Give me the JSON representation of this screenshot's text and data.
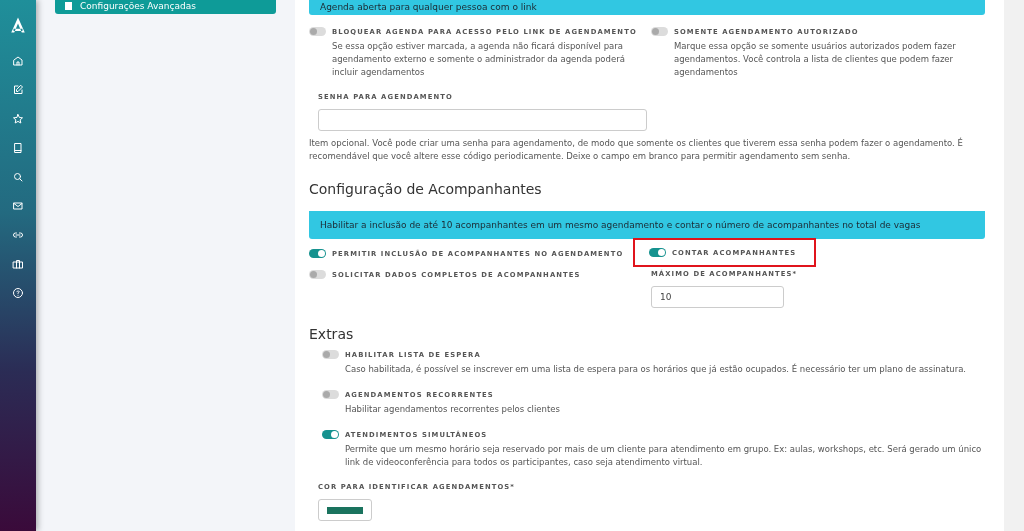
{
  "sidebar_panel": {
    "items": [
      {
        "label": "Configurações Avançadas",
        "selected": true
      }
    ]
  },
  "access": {
    "banner": "Agenda aberta para qualquer pessoa com o link",
    "toggles": [
      {
        "label": "BLOQUEAR AGENDA PARA ACESSO PELO LINK DE AGENDAMENTO",
        "description": "Se essa opção estiver marcada, a agenda não ficará disponível para agendamento externo e somente o administrador da agenda poderá incluir agendamentos",
        "on": false
      },
      {
        "label": "SOMENTE AGENDAMENTO AUTORIZADO",
        "description": "Marque essa opção se somente usuários autorizados podem fazer agendamentos. Você controla a lista de clientes que podem fazer agendamentos",
        "on": false
      }
    ],
    "password": {
      "label": "SENHA PARA AGENDAMENTO",
      "help": "Item opcional. Você pode criar uma senha para agendamento, de modo que somente os clientes que tiverem essa senha podem fazer o agendamento. É recomendável que você altere esse código periodicamente. Deixe o campo em branco para permitir agendamento sem senha."
    }
  },
  "companions": {
    "title": "Configuração de Acompanhantes",
    "banner": "Habilitar a inclusão de até 10 acompanhantes em um mesmo agendamento e contar o número de acompanhantes no total de vagas",
    "toggles": [
      {
        "label": "PERMITIR INCLUSÃO DE ACOMPANHANTES NO AGENDAMENTO",
        "on": true,
        "highlighted": false
      },
      {
        "label": "CONTAR ACOMPANHANTES",
        "on": true,
        "highlighted": true
      },
      {
        "label": "SOLICITAR DADOS COMPLETOS DE ACOMPANHANTES",
        "on": false,
        "highlighted": false
      }
    ],
    "max": {
      "label": "MÁXIMO DE ACOMPANHANTES*",
      "value": "10"
    }
  },
  "extras": {
    "title": "Extras",
    "toggles": [
      {
        "label": "HABILITAR LISTA DE ESPERA",
        "description": "Caso habilitada, é possível se inscrever em uma lista de espera para os horários que já estão ocupados. É necessário ter um plano de assinatura.",
        "on": false
      },
      {
        "label": "AGENDAMENTOS RECORRENTES",
        "description": "Habilitar agendamentos recorrentes pelos clientes",
        "on": false
      },
      {
        "label": "ATENDIMENTOS SIMULTÂNEOS",
        "description": "Permite que um mesmo horário seja reservado por mais de um cliente para atendimento em grupo. Ex: aulas, workshops, etc. Será gerado um único link de videoconferência para todos os participantes, caso seja atendimento virtual.",
        "on": true
      }
    ],
    "color_field": {
      "label": "COR PARA IDENTIFICAR AGENDAMENTOS*",
      "color": "#1a735e"
    }
  }
}
